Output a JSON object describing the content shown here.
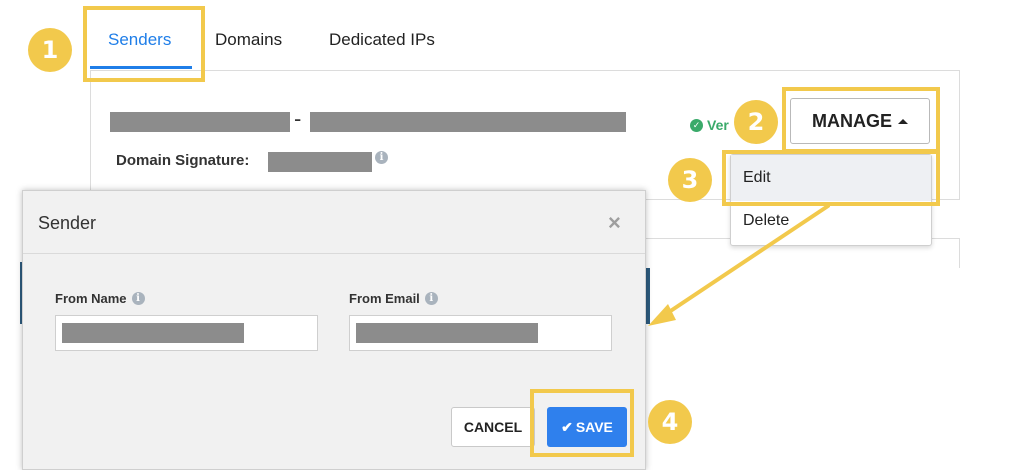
{
  "tabs": [
    {
      "label": "Senders",
      "active": true
    },
    {
      "label": "Domains",
      "active": false
    },
    {
      "label": "Dedicated IPs",
      "active": false
    }
  ],
  "sender_card": {
    "name_separator": "-",
    "domain_signature_label": "Domain Signature:",
    "verified_label": "Ver",
    "manage_label": "MANAGE"
  },
  "manage_menu": {
    "items": [
      "Edit",
      "Delete"
    ]
  },
  "modal": {
    "title": "Sender",
    "close_glyph": "×",
    "from_name_label": "From Name",
    "from_email_label": "From Email",
    "cancel_label": "CANCEL",
    "save_label": "SAVE"
  },
  "annotations": {
    "steps": [
      "1",
      "2",
      "3",
      "4"
    ],
    "highlight_color": "#f2c94c"
  },
  "colors": {
    "accent": "#1f7ee8",
    "save_button": "#2f80ed",
    "verified": "#3aaa6a"
  },
  "icons": {
    "info": "info-icon",
    "verified": "check-circle-icon",
    "caret": "caret-up-icon",
    "close": "close-icon",
    "check": "check-icon"
  }
}
